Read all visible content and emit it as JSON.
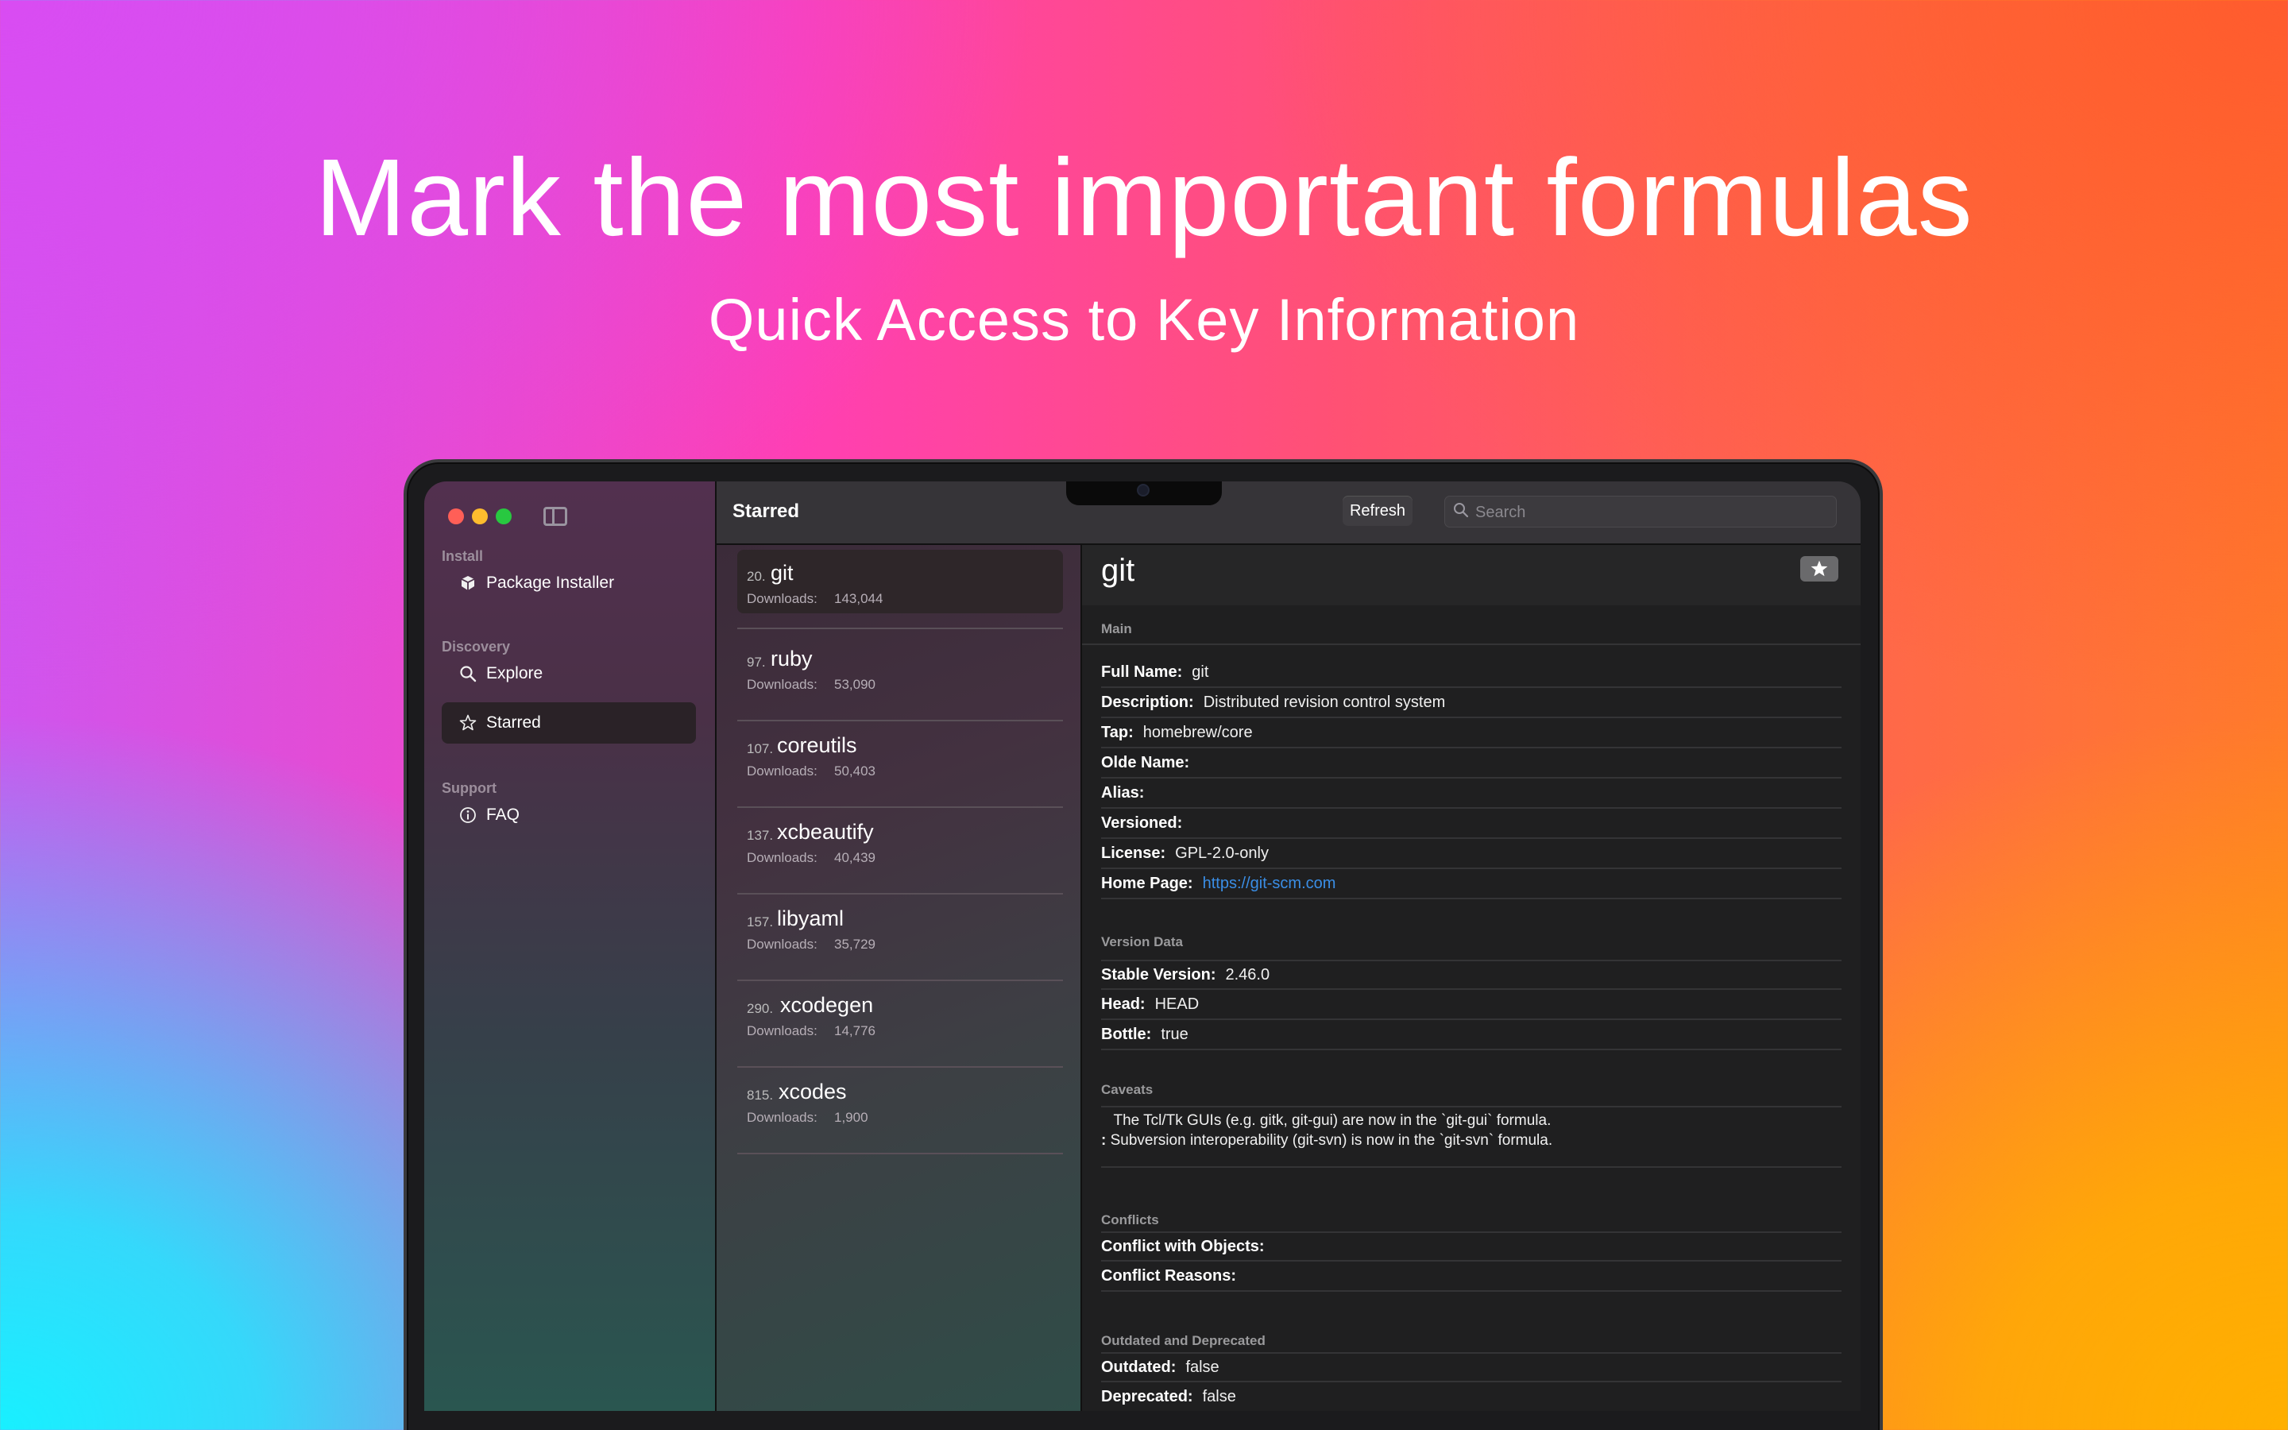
{
  "hero": {
    "headline": "Mark the most important formulas",
    "subheadline": "Quick Access to Key Information"
  },
  "sidebar": {
    "sections": [
      {
        "label": "Install",
        "items": [
          {
            "label": "Package Installer",
            "icon": "package-icon"
          }
        ]
      },
      {
        "label": "Discovery",
        "items": [
          {
            "label": "Explore",
            "icon": "magnifier-icon"
          },
          {
            "label": "Starred",
            "icon": "star-icon",
            "active": true
          }
        ]
      },
      {
        "label": "Support",
        "items": [
          {
            "label": "FAQ",
            "icon": "info-icon"
          }
        ]
      }
    ]
  },
  "toolbar": {
    "title": "Starred",
    "refresh_label": "Refresh",
    "search_placeholder": "Search"
  },
  "list": {
    "downloads_label": "Downloads:",
    "items": [
      {
        "rank": "20.",
        "name": "git",
        "downloads": "143,044",
        "selected": true
      },
      {
        "rank": "97.",
        "name": "ruby",
        "downloads": "53,090"
      },
      {
        "rank": "107.",
        "name": "coreutils",
        "downloads": "50,403"
      },
      {
        "rank": "137.",
        "name": "xcbeautify",
        "downloads": "40,439"
      },
      {
        "rank": "157.",
        "name": "libyaml",
        "downloads": "35,729"
      },
      {
        "rank": "290.",
        "name": "xcodegen",
        "downloads": "14,776"
      },
      {
        "rank": "815.",
        "name": "xcodes",
        "downloads": "1,900"
      }
    ]
  },
  "detail": {
    "title": "git",
    "star_icon": "star-icon",
    "main": {
      "label": "Main",
      "full_name_key": "Full Name:",
      "full_name": "git",
      "description_key": "Description:",
      "description": "Distributed revision control system",
      "tap_key": "Tap:",
      "tap": "homebrew/core",
      "olde_name_key": "Olde Name:",
      "alias_key": "Alias:",
      "versioned_key": "Versioned:",
      "license_key": "License:",
      "license": "GPL-2.0-only",
      "home_page_key": "Home Page:",
      "home_page": "https://git-scm.com"
    },
    "version_data": {
      "label": "Version Data",
      "stable_key": "Stable Version:",
      "stable": "2.46.0",
      "head_key": "Head:",
      "head": "HEAD",
      "bottle_key": "Bottle:",
      "bottle": "true"
    },
    "caveats": {
      "label": "Caveats",
      "line1": "The Tcl/Tk GUIs (e.g. gitk, git-gui) are now in the `git-gui` formula.",
      "line2": "Subversion interoperability (git-svn) is now in the `git-svn` formula."
    },
    "conflicts": {
      "label": "Conflicts",
      "objects_key": "Conflict with Objects:",
      "reasons_key": "Conflict Reasons:"
    },
    "outdated": {
      "label": "Outdated and Deprecated",
      "outdated_key": "Outdated:",
      "outdated": "false",
      "deprecated_key": "Deprecated:",
      "deprecated": "false"
    }
  }
}
